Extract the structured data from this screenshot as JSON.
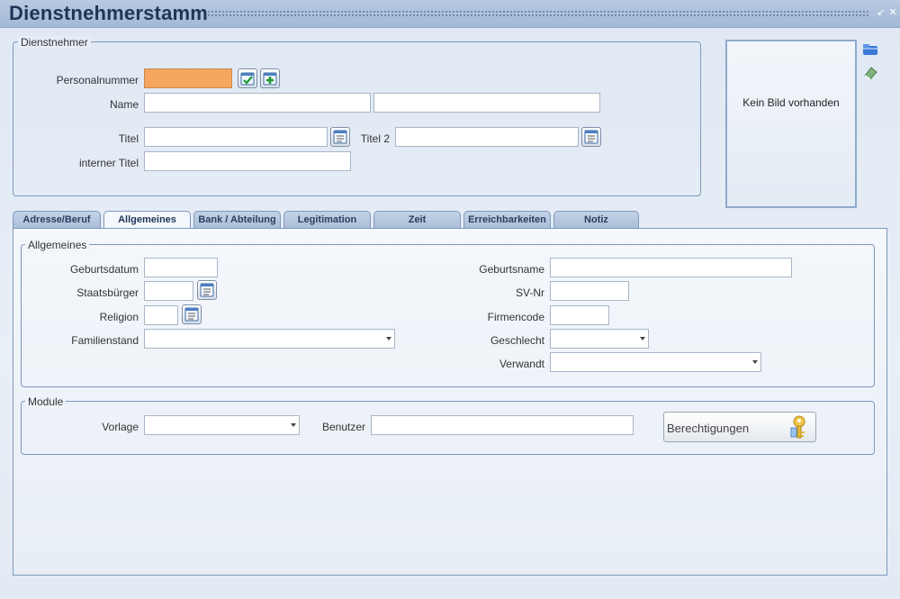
{
  "window": {
    "title": "Dienstnehmerstamm"
  },
  "employee_group": {
    "legend": "Dienstnehmer",
    "personalnummer_label": "Personalnummer",
    "personalnummer_value": "",
    "name_label": "Name",
    "name_first_value": "",
    "name_last_value": "",
    "titel_label": "Titel",
    "titel_value": "",
    "titel2_label": "Titel 2",
    "titel2_value": "",
    "interner_titel_label": "interner Titel",
    "interner_titel_value": ""
  },
  "photo": {
    "text": "Kein Bild vorhanden"
  },
  "tabs": [
    {
      "label": "Adresse/Beruf"
    },
    {
      "label": "Allgemeines"
    },
    {
      "label": "Bank / Abteilung"
    },
    {
      "label": "Legitimation"
    },
    {
      "label": "Zeit"
    },
    {
      "label": "Erreichbarkeiten"
    },
    {
      "label": "Notiz"
    }
  ],
  "active_tab": "Allgemeines",
  "general_group": {
    "legend": "Allgemeines",
    "geburtsdatum_label": "Geburtsdatum",
    "geburtsdatum_value": "",
    "staatsbuerger_label": "Staatsbürger",
    "staatsbuerger_value": "",
    "religion_label": "Religion",
    "religion_value": "",
    "familienstand_label": "Familienstand",
    "familienstand_value": "",
    "geburtsname_label": "Geburtsname",
    "geburtsname_value": "",
    "svnr_label": "SV-Nr",
    "svnr_value": "",
    "firmencode_label": "Firmencode",
    "firmencode_value": "",
    "geschlecht_label": "Geschlecht",
    "geschlecht_value": "",
    "verwandt_label": "Verwandt",
    "verwandt_value": ""
  },
  "module_group": {
    "legend": "Module",
    "vorlage_label": "Vorlage",
    "vorlage_value": "",
    "benutzer_label": "Benutzer",
    "benutzer_value": "",
    "berechtigungen_label": "Berechtigungen"
  },
  "colors": {
    "personalnummer_bg": "#f6a65f",
    "accent": "#1f3556"
  }
}
